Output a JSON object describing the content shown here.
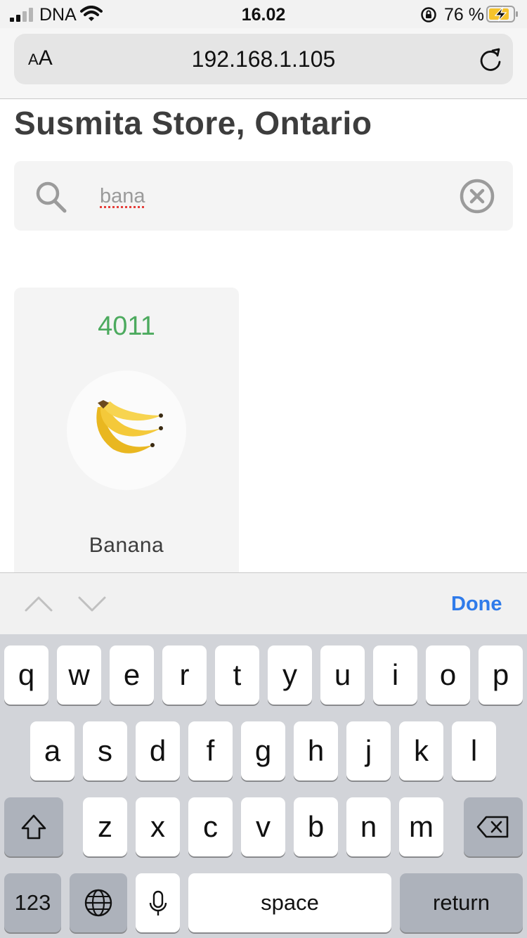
{
  "status_bar": {
    "carrier": "DNA",
    "time": "16.02",
    "battery_percent": "76 %"
  },
  "browser": {
    "text_size_button": {
      "small": "A",
      "large": "A"
    },
    "url": "192.168.1.105"
  },
  "page": {
    "title": "Susmita Store, Ontario",
    "search": {
      "value": "bana"
    },
    "products": [
      {
        "code": "4011",
        "name": "Banana"
      }
    ]
  },
  "accessory_bar": {
    "done_label": "Done"
  },
  "keyboard": {
    "row1": [
      "q",
      "w",
      "e",
      "r",
      "t",
      "y",
      "u",
      "i",
      "o",
      "p"
    ],
    "row2": [
      "a",
      "s",
      "d",
      "f",
      "g",
      "h",
      "j",
      "k",
      "l"
    ],
    "row3": [
      "z",
      "x",
      "c",
      "v",
      "b",
      "n",
      "m"
    ],
    "numbers_label": "123",
    "space_label": "space",
    "return_label": "return"
  },
  "colors": {
    "accent_blue": "#2f7bea",
    "product_code_green": "#4caa5e",
    "keyboard_bg": "#d2d4d9"
  }
}
